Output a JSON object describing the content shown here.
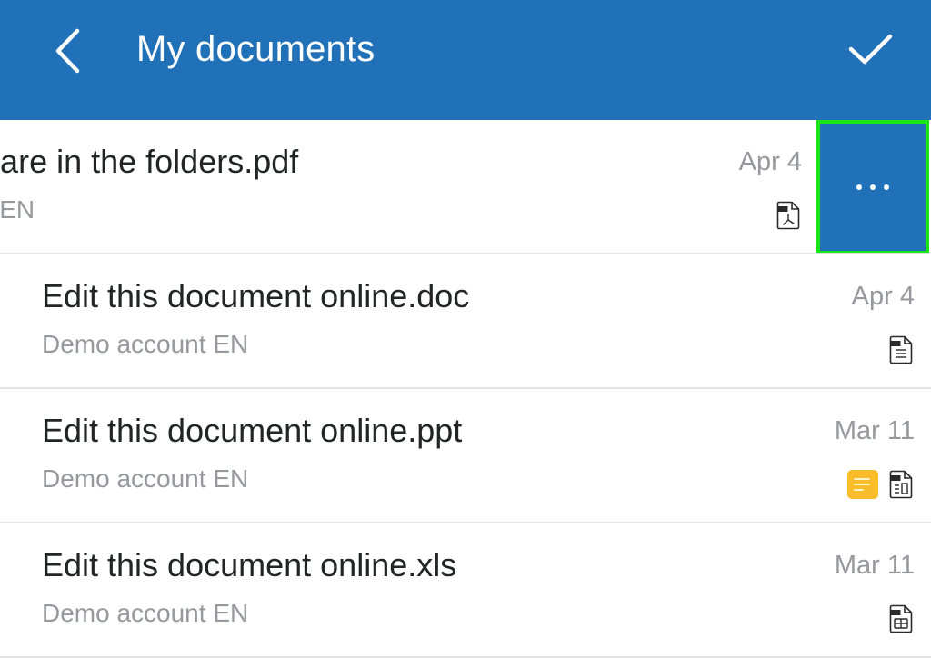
{
  "header": {
    "title": "My documents",
    "back_icon": "chevron-left-icon",
    "confirm_icon": "checkmark-icon",
    "background_color": "#2171b8"
  },
  "documents": [
    {
      "title": "Where documents are in the folders.pdf",
      "visible_title": "uments are in the folders.pdf",
      "subtitle": "Demo account EN",
      "visible_subtitle": "o account EN",
      "date": "Apr 4",
      "file_type": "pdf",
      "file_icon": "pdf-file-icon",
      "has_note": false,
      "swiped": true,
      "action": {
        "label": "...",
        "icon": "more-horizontal-icon",
        "highlighted": true,
        "highlight_color": "#19e619"
      }
    },
    {
      "title": "Edit this document online.doc",
      "subtitle": "Demo account EN",
      "date": "Apr 4",
      "file_type": "doc",
      "file_icon": "doc-file-icon",
      "has_note": false
    },
    {
      "title": "Edit this document online.ppt",
      "subtitle": "Demo account EN",
      "date": "Mar 11",
      "file_type": "ppt",
      "file_icon": "ppt-file-icon",
      "has_note": true,
      "note_icon": "note-icon",
      "note_color": "#f9bd2c"
    },
    {
      "title": "Edit this document online.xls",
      "subtitle": "Demo account EN",
      "date": "Mar 11",
      "file_type": "xls",
      "file_icon": "xls-file-icon",
      "has_note": false
    }
  ]
}
